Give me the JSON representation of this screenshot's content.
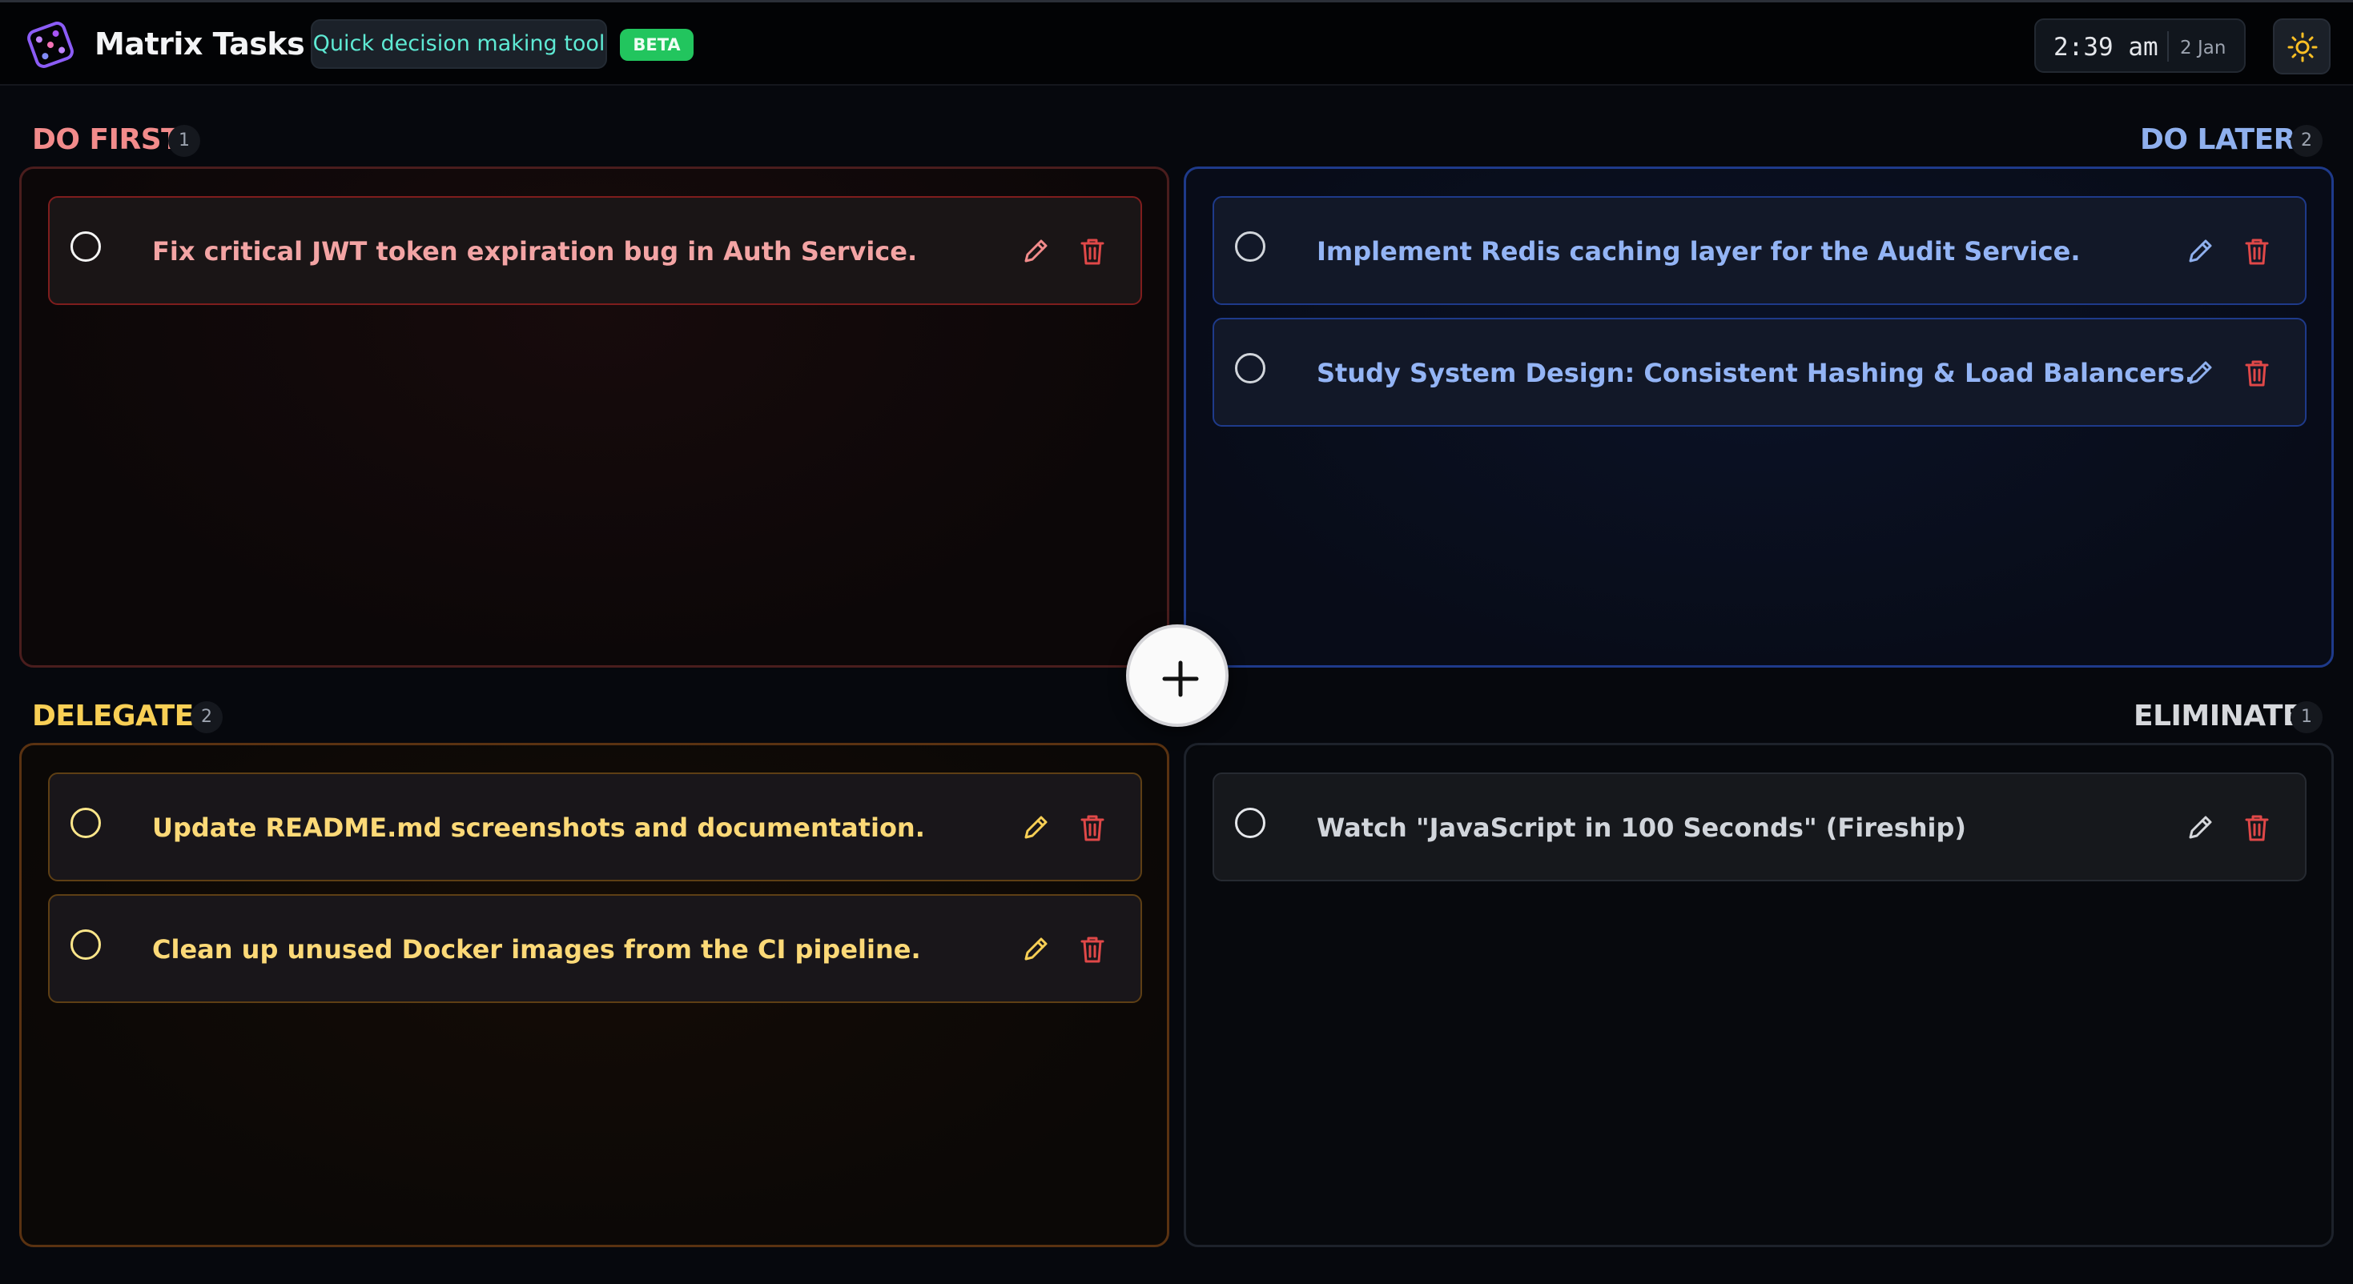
{
  "app": {
    "title": "Matrix Tasks",
    "subtitle": "Quick decision making tool",
    "badge": "BETA"
  },
  "clock": {
    "time": "2:39 am",
    "date": "2 Jan"
  },
  "icons": {
    "logo": "dice-logo-icon",
    "theme": "sun-icon",
    "add": "plus-icon",
    "edit": "pencil-icon",
    "delete": "trash-icon",
    "checkbox": "circle-icon"
  },
  "colors": {
    "do_first": "#f28b8b",
    "do_later": "#8fb0ee",
    "delegate": "#f8cf55",
    "eliminate": "#d6d8dc",
    "delete_icon": "#e04848",
    "beta_badge": "#22c55e",
    "subtitle_text": "#5eead4"
  },
  "quadrants": {
    "do_first": {
      "label": "DO FIRST",
      "count": "1",
      "tasks": [
        {
          "text": "Fix critical JWT token expiration bug in Auth Service."
        }
      ]
    },
    "do_later": {
      "label": "DO LATER",
      "count": "2",
      "tasks": [
        {
          "text": "Implement Redis caching layer for the Audit Service."
        },
        {
          "text": "Study System Design: Consistent Hashing & Load Balancers."
        }
      ]
    },
    "delegate": {
      "label": "DELEGATE",
      "count": "2",
      "tasks": [
        {
          "text": "Update README.md screenshots and documentation."
        },
        {
          "text": "Clean up unused Docker images from the CI pipeline."
        }
      ]
    },
    "eliminate": {
      "label": "ELIMINATE",
      "count": "1",
      "tasks": [
        {
          "text": "Watch \"JavaScript in 100 Seconds\" (Fireship)"
        }
      ]
    }
  }
}
